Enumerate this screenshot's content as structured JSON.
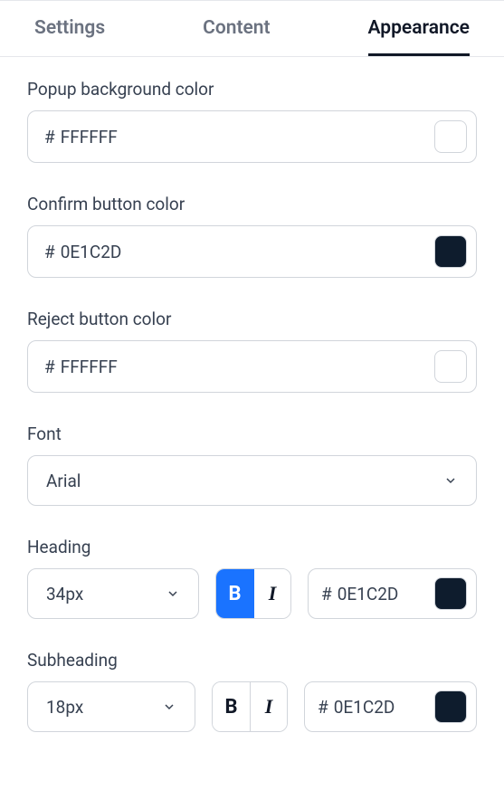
{
  "tabs": {
    "settings": "Settings",
    "content": "Content",
    "appearance": "Appearance"
  },
  "popup_bg": {
    "label": "Popup background color",
    "value": "FFFFFF",
    "swatch": "#FFFFFF"
  },
  "confirm_btn": {
    "label": "Confirm button color",
    "value": "0E1C2D",
    "swatch": "#0E1C2D"
  },
  "reject_btn": {
    "label": "Reject button color",
    "value": "FFFFFF",
    "swatch": "#FFFFFF"
  },
  "font": {
    "label": "Font",
    "value": "Arial"
  },
  "heading": {
    "label": "Heading",
    "size": "34px",
    "bold": true,
    "italic": false,
    "color_value": "0E1C2D",
    "swatch": "#0E1C2D"
  },
  "subheading": {
    "label": "Subheading",
    "size": "18px",
    "bold": false,
    "italic": false,
    "color_value": "0E1C2D",
    "swatch": "#0E1C2D"
  },
  "glyphs": {
    "hash": "#",
    "bold": "B",
    "italic": "I"
  }
}
